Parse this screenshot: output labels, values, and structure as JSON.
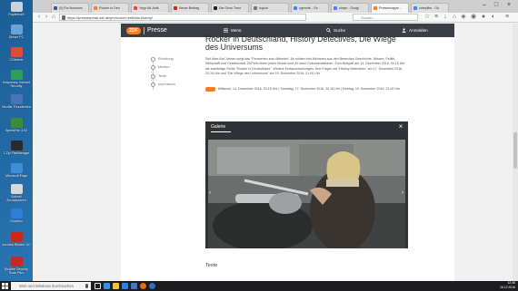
{
  "desktop": {
    "icons": [
      {
        "label": "Papierkorb",
        "color": "#c7d3de"
      },
      {
        "label": "Dieser PC",
        "color": "#6aa4d6"
      },
      {
        "label": "CCleaner",
        "color": "#e04a3a"
      },
      {
        "label": "Kaspersky Internet Security",
        "color": "#2f9e5a"
      },
      {
        "label": "Mozilla Thunderbird",
        "color": "#4a74b8"
      },
      {
        "label": "SpeedFan 4.52",
        "color": "#3c8c3c"
      },
      {
        "label": "7-Zip FileManager",
        "color": "#2b2b2b"
      },
      {
        "label": "Microsoft Edge",
        "color": "#3a8fd6"
      },
      {
        "label": "Schnell Zurücksetzen",
        "color": "#d9d9d9"
      },
      {
        "label": "Dropbox",
        "color": "#2d7fd8"
      },
      {
        "label": "Acrobat Reader DC",
        "color": "#c9281d"
      },
      {
        "label": "McAfee Security Scan Plus",
        "color": "#c22a2a"
      }
    ]
  },
  "browser": {
    "tabs": [
      {
        "label": "(0) Ein Nonsens",
        "color": "#3b5998"
      },
      {
        "label": "Rocker in Deu",
        "color": "#ff7d1e"
      },
      {
        "label": "Yopp Ab-Aufk",
        "color": "#e94b35"
      },
      {
        "label": "Neuer Beitrag",
        "color": "#c9281d"
      },
      {
        "label": "Die Grow Trent",
        "color": "#222222"
      },
      {
        "label": "logout",
        "color": "#777777"
      },
      {
        "label": "zgeroite - Go",
        "color": "#4285f4"
      },
      {
        "label": "uhapr - Googl",
        "color": "#4285f4"
      },
      {
        "label": "Pressemappe -",
        "color": "#ff7d1e"
      },
      {
        "label": "zuteplike - Go",
        "color": "#4285f4"
      }
    ],
    "url": "https://presseportal.zdf.de/pm/rocker-selfelds-history/",
    "search_placeholder": "Suchen"
  },
  "site": {
    "logo": "ZDF",
    "section": "Presse",
    "menu_label": "Menü",
    "search_label": "Suche",
    "login_label": "Anmelden"
  },
  "article": {
    "headline": "Rocker in Deutschland, History Detectives, Die Wiege des Universums",
    "side_nav": [
      "Einleitung",
      "Medien",
      "Texte",
      "Impressum"
    ],
    "body": "Seit über fünf Jahren sorgt das \"Fernsehen zum Mitreden\" für echten Info-Mehrwert aus den Bereichen Geschichte, Wissen, Politik, Wirtschaft und Gesellschaft. ZDFinfo bietet jeden Monat rund 50 neue Dokumentationen. Zum Beispiel am 14. Dezember 2016, 20.15 Uhr die zweiteilige Reihe \"Rocker in Deutschland\". Weitere Erstausstrahlungen: Drei Folgen mit \"History Detectives\" am 17. Dezember 2016, 20.15 Uhr und \"Die Wiege des Universums\" am 19. Dezember 2016, 21.00 Uhr.",
    "dates": "Mittwoch, 14. Dezember 2016, 20.15 Uhr | Samstag, 17. Dezember 2016, 20.15 Uhr | Montag, 19. Dezember 2016, 21.00 Uhr",
    "gallery_title": "Galerie",
    "section_texte": "Texte"
  },
  "taskbar": {
    "search_placeholder": "Web und Windows durchsuchen",
    "time": "12:46",
    "date": "16.12.2016",
    "apps": [
      {
        "name": "task-view",
        "color": "#e8e8e8"
      },
      {
        "name": "edge",
        "color": "#3a8fd6"
      },
      {
        "name": "explorer",
        "color": "#f0c14b"
      },
      {
        "name": "store",
        "color": "#2d7fd8"
      },
      {
        "name": "mail",
        "color": "#4a74b8"
      },
      {
        "name": "firefox",
        "color": "#e66a1d"
      },
      {
        "name": "thunderbird",
        "color": "#2f6fb8"
      }
    ]
  }
}
